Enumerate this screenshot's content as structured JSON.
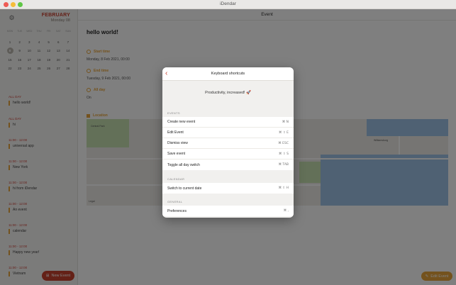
{
  "window": {
    "title": "iDendar"
  },
  "sidebar": {
    "month": "FEBRUARY",
    "date_line": "Monday 08",
    "weekdays": [
      "MON",
      "TUE",
      "WED",
      "THU",
      "FRI",
      "SAT",
      "SUN"
    ],
    "weeks": [
      [
        "1",
        "2",
        "3",
        "4",
        "5",
        "6",
        "7"
      ],
      [
        "8",
        "9",
        "10",
        "11",
        "12",
        "13",
        "14"
      ],
      [
        "15",
        "16",
        "17",
        "18",
        "19",
        "20",
        "21"
      ],
      [
        "22",
        "23",
        "24",
        "25",
        "26",
        "27",
        "28"
      ]
    ],
    "today": "8",
    "groups": [
      {
        "head": "ALL DAY",
        "item": "hello world!"
      },
      {
        "head": "ALL DAY",
        "item": "hi"
      },
      {
        "head": "11:00 - 12:00",
        "item": "universal app"
      },
      {
        "head": "11:00 - 12:00",
        "item": "New York"
      },
      {
        "head": "11:00 - 12:00",
        "item": "hi from iDendar"
      },
      {
        "head": "11:00 - 12:00",
        "item": "An event"
      },
      {
        "head": "11:00 - 12:00",
        "item": "calendar"
      },
      {
        "head": "11:00 - 12:00",
        "item": "Happy new year!"
      },
      {
        "head": "11:00 - 12:00",
        "item": "Vietnam"
      }
    ],
    "new_event_label": "New Event"
  },
  "main": {
    "header": "Event",
    "event_title": "hello world!",
    "start_label": "Start time",
    "start_value": "Monday, 8 Feb 2021, 00:00",
    "end_label": "End time",
    "end_value": "Tuesday, 9 Feb 2021, 00:00",
    "allday_label": "All day",
    "allday_value": "On",
    "location_label": "Location",
    "map_labels": [
      "Central Park",
      "Williamsburg",
      "Legal"
    ],
    "edit_event_label": "Edit Event"
  },
  "modal": {
    "title": "Keyboard shortcuts",
    "tagline": "Productivity, increased! 🚀",
    "sections": [
      {
        "head": "EVENTS",
        "rows": [
          {
            "name": "Create new event",
            "key": "⌘ N"
          },
          {
            "name": "Edit Event",
            "key": "⌘ ⇧ E"
          },
          {
            "name": "Dismiss view",
            "key": "⌘ ESC"
          },
          {
            "name": "Save event",
            "key": "⌘ ⇧ S"
          },
          {
            "name": "Toggle all day switch",
            "key": "⌘ TAB"
          }
        ]
      },
      {
        "head": "CALENDAR",
        "rows": [
          {
            "name": "Switch to current date",
            "key": "⌘ ⇧ H"
          }
        ]
      },
      {
        "head": "GENERAL",
        "rows": [
          {
            "name": "Preferences",
            "key": "⌘ ,"
          }
        ]
      }
    ]
  },
  "colors": {
    "accent_red": "#c9402e",
    "accent_orange": "#e8a53a"
  },
  "icons": {
    "settings": "gear-icon",
    "back": "chevron-left-icon",
    "new_event": "plus-square-icon"
  }
}
